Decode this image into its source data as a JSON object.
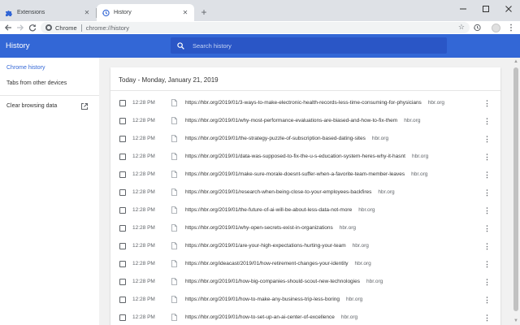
{
  "tabs": [
    {
      "title": "Extensions",
      "icon": "puzzle-icon"
    },
    {
      "title": "History",
      "icon": "history-icon"
    }
  ],
  "toolbar": {
    "chrome_label": "Chrome",
    "url": "chrome://history"
  },
  "header": {
    "title": "History",
    "search_placeholder": "Search history"
  },
  "sidebar": {
    "items": [
      {
        "label": "Chrome history"
      },
      {
        "label": "Tabs from other devices"
      },
      {
        "label": "Clear browsing data"
      }
    ]
  },
  "main": {
    "date_header": "Today - Monday, January 21, 2019",
    "entries": [
      {
        "time": "12:28 PM",
        "url": "https://hbr.org/2019/01/3-ways-to-make-electronic-health-records-less-time-consuming-for-physicians",
        "domain": "hbr.org"
      },
      {
        "time": "12:28 PM",
        "url": "https://hbr.org/2019/01/why-most-performance-evaluations-are-biased-and-how-to-fix-them",
        "domain": "hbr.org"
      },
      {
        "time": "12:28 PM",
        "url": "https://hbr.org/2019/01/the-strategy-puzzle-of-subscription-based-dating-sites",
        "domain": "hbr.org"
      },
      {
        "time": "12:28 PM",
        "url": "https://hbr.org/2019/01/data-was-supposed-to-fix-the-u-s-education-system-heres-why-it-hasnt",
        "domain": "hbr.org"
      },
      {
        "time": "12:28 PM",
        "url": "https://hbr.org/2019/01/make-sure-morale-doesnt-suffer-when-a-favorite-team-member-leaves",
        "domain": "hbr.org"
      },
      {
        "time": "12:28 PM",
        "url": "https://hbr.org/2019/01/research-when-being-close-to-your-employees-backfires",
        "domain": "hbr.org"
      },
      {
        "time": "12:28 PM",
        "url": "https://hbr.org/2019/01/the-future-of-ai-will-be-about-less-data-not-more",
        "domain": "hbr.org"
      },
      {
        "time": "12:28 PM",
        "url": "https://hbr.org/2019/01/why-open-secrets-exist-in-organizations",
        "domain": "hbr.org"
      },
      {
        "time": "12:28 PM",
        "url": "https://hbr.org/2019/01/are-your-high-expectations-hurting-your-team",
        "domain": "hbr.org"
      },
      {
        "time": "12:28 PM",
        "url": "https://hbr.org/ideacast/2019/01/how-retirement-changes-your-identity",
        "domain": "hbr.org"
      },
      {
        "time": "12:28 PM",
        "url": "https://hbr.org/2019/01/how-big-companies-should-scout-new-technologies",
        "domain": "hbr.org"
      },
      {
        "time": "12:28 PM",
        "url": "https://hbr.org/2019/01/how-to-make-any-business-trip-less-boring",
        "domain": "hbr.org"
      },
      {
        "time": "12:28 PM",
        "url": "https://hbr.org/2019/01/how-to-set-up-an-ai-center-of-excellence",
        "domain": "hbr.org"
      }
    ]
  },
  "colors": {
    "header_blue": "#3367d6",
    "search_blue": "#2a56c6",
    "selected_text": "#3367d6",
    "page_bg": "#f1f1f1"
  }
}
